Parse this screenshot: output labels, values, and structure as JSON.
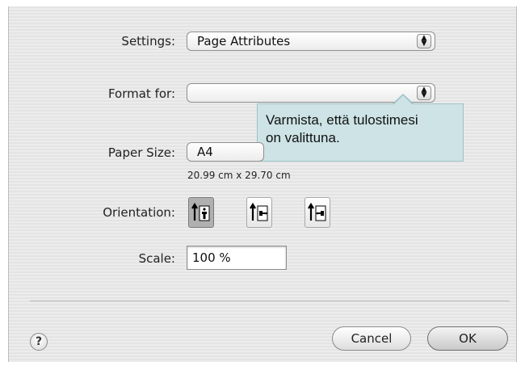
{
  "settings": {
    "label": "Settings:",
    "value": "Page Attributes"
  },
  "format_for": {
    "label": "Format for:",
    "value": ""
  },
  "tooltip": {
    "line1": "Varmista, että tulostimesi",
    "line2": "on valittuna."
  },
  "paper_size": {
    "label": "Paper Size:",
    "value": "A4",
    "dimensions": "20.99 cm x 29.70 cm"
  },
  "orientation": {
    "label": "Orientation:",
    "options": [
      "portrait",
      "landscape-left",
      "landscape-right"
    ],
    "selected": "portrait"
  },
  "scale": {
    "label": "Scale:",
    "value": "100 %"
  },
  "buttons": {
    "help": "?",
    "cancel": "Cancel",
    "ok": "OK"
  },
  "colors": {
    "tooltip_bg": "#cde3e5",
    "dialog_bg": "#ececec"
  }
}
